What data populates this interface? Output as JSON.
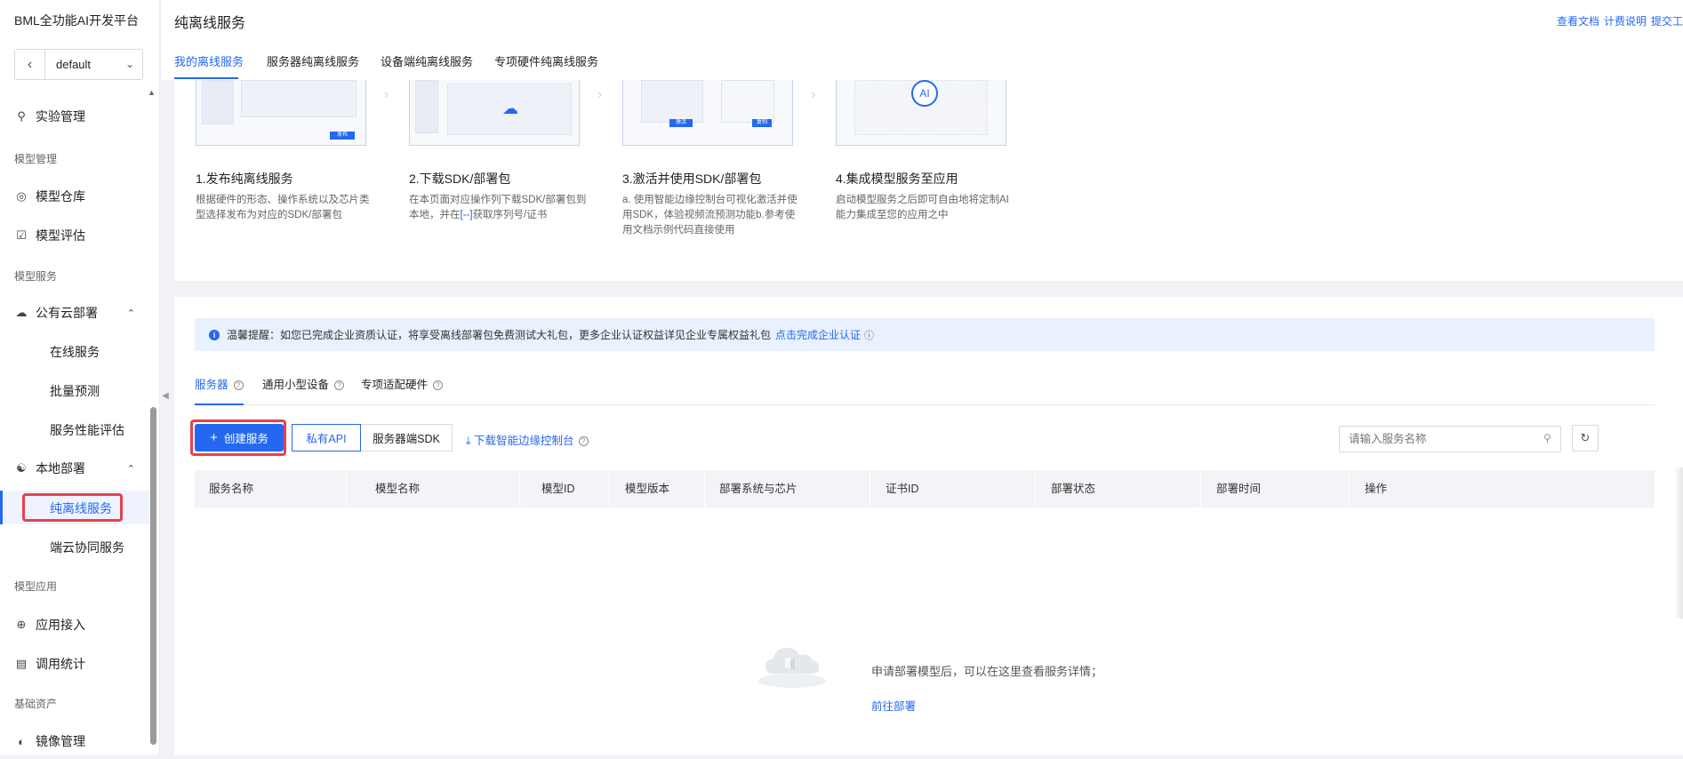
{
  "app": {
    "brand": "BML全功能AI开发平台"
  },
  "workspace": {
    "value": "default"
  },
  "sidebar": {
    "items": [
      {
        "label": "实验管理",
        "icon": "flask-icon"
      },
      {
        "group": "模型管理"
      },
      {
        "label": "模型仓库",
        "icon": "repository-icon"
      },
      {
        "label": "模型评估",
        "icon": "evaluate-icon"
      },
      {
        "group": "模型服务"
      },
      {
        "label": "公有云部署",
        "icon": "cloud-icon"
      },
      {
        "label": "在线服务"
      },
      {
        "label": "批量预测"
      },
      {
        "label": "服务性能评估"
      },
      {
        "label": "本地部署",
        "icon": "local-deploy-icon"
      },
      {
        "label": "纯离线服务"
      },
      {
        "label": "端云协同服务"
      },
      {
        "group": "模型应用"
      },
      {
        "label": "应用接入",
        "icon": "app-access-icon"
      },
      {
        "label": "调用统计",
        "icon": "stats-icon"
      },
      {
        "group": "基础资产"
      },
      {
        "label": "镜像管理",
        "icon": "image-icon"
      }
    ]
  },
  "header": {
    "title": "纯离线服务",
    "links": [
      "查看文档",
      "计费说明",
      "提交工"
    ],
    "tabs": [
      "我的离线服务",
      "服务器纯离线服务",
      "设备端纯离线服务",
      "专项硬件纯离线服务"
    ]
  },
  "steps": [
    {
      "title": "1.发布纯离线服务",
      "desc": "根据硬件的形态、操作系统以及芯片类型选择发布为对应的SDK/部署包",
      "img_btn": "发布"
    },
    {
      "title": "2.下载SDK/部署包",
      "desc_a": "在本页面对应操作列下载SDK/部署包到本地，并在",
      "desc_link": "[--]",
      "desc_b": "获取序列号/证书"
    },
    {
      "title": "3.激活并使用SDK/部署包",
      "desc": "a. 使用智能边缘控制台可视化激活并使用SDK，体验视频流预测功能b.参考使用文档示例代码直接使用",
      "img_btn1": "激活",
      "img_btn2": "复制"
    },
    {
      "title": "4.集成模型服务至应用",
      "desc": "启动模型服务之后即可自由地将定制AI能力集成至您的应用之中",
      "img_badge": "AI"
    }
  ],
  "notice": {
    "text": "温馨提醒：如您已完成企业资质认证，将享受离线部署包免费测试大礼包，更多企业认证权益详见企业专属权益礼包",
    "link": "点击完成企业认证"
  },
  "sub_tabs": [
    "服务器",
    "通用小型设备",
    "专项适配硬件"
  ],
  "toolbar": {
    "create": "创建服务",
    "seg": [
      "私有API",
      "服务器端SDK"
    ],
    "download": "下载智能边缘控制台",
    "search_placeholder": "请输入服务名称"
  },
  "table": {
    "columns": [
      "服务名称",
      "模型名称",
      "模型ID",
      "模型版本",
      "部署系统与芯片",
      "证书ID",
      "部署状态",
      "部署时间",
      "操作"
    ]
  },
  "empty": {
    "text": "申请部署模型后，可以在这里查看服务详情；",
    "link": "前往部署"
  },
  "colors": {
    "accent": "#2468f2",
    "highlight": "#e8414b"
  }
}
